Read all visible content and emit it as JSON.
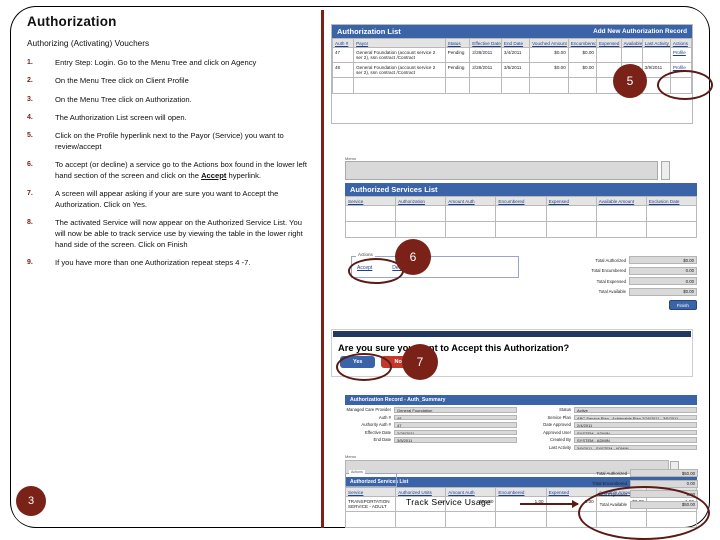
{
  "slide": {
    "title": "Authorization",
    "subtitle": "Authorizing (Activating) Vouchers",
    "steps": [
      {
        "num": "1.",
        "text": "Entry Step: Login. Go to the Menu Tree and click on Agency"
      },
      {
        "num": "2.",
        "text": "On the  Menu Tree click on Client Profile"
      },
      {
        "num": "3.",
        "text": "On the Menu Tree click on Authorization."
      },
      {
        "num": "4.",
        "text": "The Authorization List screen will open."
      },
      {
        "num": "5.",
        "text": "Click on the Profile hyperlink next to the Payor (Service) you want to review/accept"
      },
      {
        "num": "6a",
        "text": "To accept (or decline) a service go to the Actions box found in the lower left hand section of the screen and click on the "
      },
      {
        "num": "6b",
        "text": "Accept"
      },
      {
        "num": "6c",
        "text": " hyperlink."
      },
      {
        "num": "7.",
        "text": "A  screen will appear asking if your are sure you want to Accept the Authorization.  Click on Yes."
      },
      {
        "num": "8.",
        "text": "The activated Service will now appear on the Authorized Service List.  You will now be able to track service use by viewing the table in the  lower right hand side of the screen. Click on Finish"
      },
      {
        "num": "9.",
        "text": "If you have more than one Authorization repeat steps 4 -7."
      }
    ],
    "step6_num": "6.",
    "callouts": {
      "three": "3",
      "five": "5",
      "six": "6",
      "seven": "7"
    },
    "accent_maroon": "#7A2218",
    "accent_blue": "#3A63A8"
  },
  "auth_list": {
    "header_title": "Authorization List",
    "add_link": "Add New Authorization Record",
    "columns": [
      "Auth #",
      "Payor",
      "Status",
      "Effective Date",
      "End Date",
      "Vouched Amount",
      "Encumbered",
      "Expensed",
      "Available",
      "Last Activity Date",
      "Actions"
    ],
    "rows": [
      {
        "auth": "47",
        "payor": "General Foundation (account service 2 ser 2), ssn contract /Contract",
        "status": "Pending",
        "eff": "2/28/2011",
        "end": "3/4/2011",
        "vouched": "$0.00",
        "encumbered": "$0.00",
        "expensed": "",
        "available": "",
        "last": "",
        "action": "Profile"
      },
      {
        "auth": "48",
        "payor": "General Foundation (account service 2 ser 2), ssn contract /Contract",
        "status": "Pending",
        "eff": "2/28/2011",
        "end": "3/5/2011",
        "vouched": "$0.00",
        "encumbered": "$0.00",
        "expensed": "",
        "available": "$0.00",
        "last": "3/9/2011",
        "action": "Profile"
      }
    ]
  },
  "services_list": {
    "header_title": "Authorized Services List",
    "memo_label": "Memo",
    "columns": [
      "Service",
      "Authorization",
      "Amount Auth",
      "Encumbered",
      "Expensed",
      "Available Amount",
      "Exclusion Date"
    ],
    "empty_rows": 3
  },
  "actions_panel": {
    "legend": "Actions",
    "accept_link": "Accept",
    "decline_link": "Decline",
    "totals": [
      {
        "label": "Total Authorized",
        "value": "$0.00"
      },
      {
        "label": "Total Encumbered",
        "value": "0.00"
      },
      {
        "label": "Total Expensed",
        "value": "0.00"
      },
      {
        "label": "Total Available",
        "value": "$0.00"
      }
    ],
    "finish_button": "Finish"
  },
  "confirm_dialog": {
    "question": "Are you sure you want to Accept this Authorization?",
    "yes": "Yes",
    "no": "No"
  },
  "detail_form": {
    "header_title": "Authorization Record - Auth_Summary",
    "left_fields": [
      {
        "label": "Managed Care Provider",
        "value": "General Foundation"
      },
      {
        "label": "Auth #",
        "value": "48"
      },
      {
        "label": "Authority Auth #",
        "value": "47"
      },
      {
        "label": "Effective Date",
        "value": "2/28/2011"
      },
      {
        "label": "End Date",
        "value": "3/5/2011"
      }
    ],
    "right_fields": [
      {
        "label": "Status",
        "value": "Active"
      },
      {
        "label": "Service Plan",
        "value": "ABC Service Plan - Achievable Plan 2/28/2011 - 3/5/2011"
      },
      {
        "label": "Date Approved",
        "value": "2/4/2011"
      },
      {
        "label": "Approved User",
        "value": "SYSTEM - ADMIN"
      },
      {
        "label": "Created By",
        "value": "SYSTEM - ADMIN"
      },
      {
        "label": "Last Activity",
        "value": "3/9/2011 - SYSTEM - ADMIN"
      }
    ],
    "memo_label": "Memo",
    "services_header": "Authorized Services List",
    "service_columns": [
      "Service",
      "Authorized Units",
      "Amount Auth",
      "Encumbered",
      "Expensed",
      "Available Amount",
      "Exclusion Date"
    ],
    "service_row": {
      "service": "TRANSPORTATION SERVICE - ADULT",
      "units": "1",
      "amount": "$50.00",
      "encumbered": "1.00",
      "expensed": "0.00",
      "available": "$0.00",
      "exclusion": "1.00"
    },
    "actions_legend": "Actions",
    "totals": [
      {
        "label": "Total Authorized",
        "value": "$50.00"
      },
      {
        "label": "Total Encumbered",
        "value": "0.00"
      },
      {
        "label": "Total Expensed",
        "value": "0.00"
      },
      {
        "label": "Total Available",
        "value": "$50.00"
      }
    ],
    "caption": "Track Service Usage"
  }
}
